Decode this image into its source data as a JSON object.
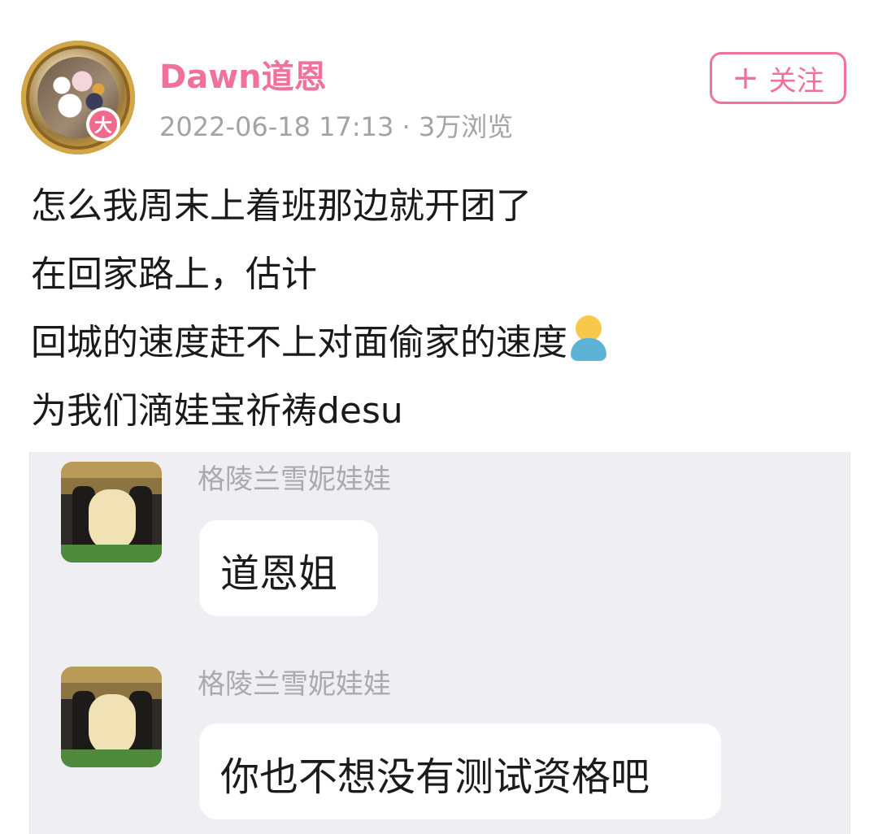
{
  "post": {
    "username": "Dawn道恩",
    "level_badge": "大",
    "meta": "2022-06-18 17:13 · 3万浏览",
    "follow_label": "关注",
    "follow_icon": "plus-icon",
    "lines": [
      "怎么我周末上着班那边就开团了",
      "在回家路上，估计",
      "回城的速度赶不上对面偷家的速度",
      "为我们滴娃宝祈祷desu"
    ],
    "emoji": "person-in-lotus-position-emoji",
    "accent_color": "#f0719a"
  },
  "screenshot": {
    "messages": [
      {
        "sender": "格陵兰雪妮娃娃",
        "text": "道恩姐"
      },
      {
        "sender": "格陵兰雪妮娃娃",
        "text": "你也不想没有测试资格吧"
      }
    ]
  }
}
